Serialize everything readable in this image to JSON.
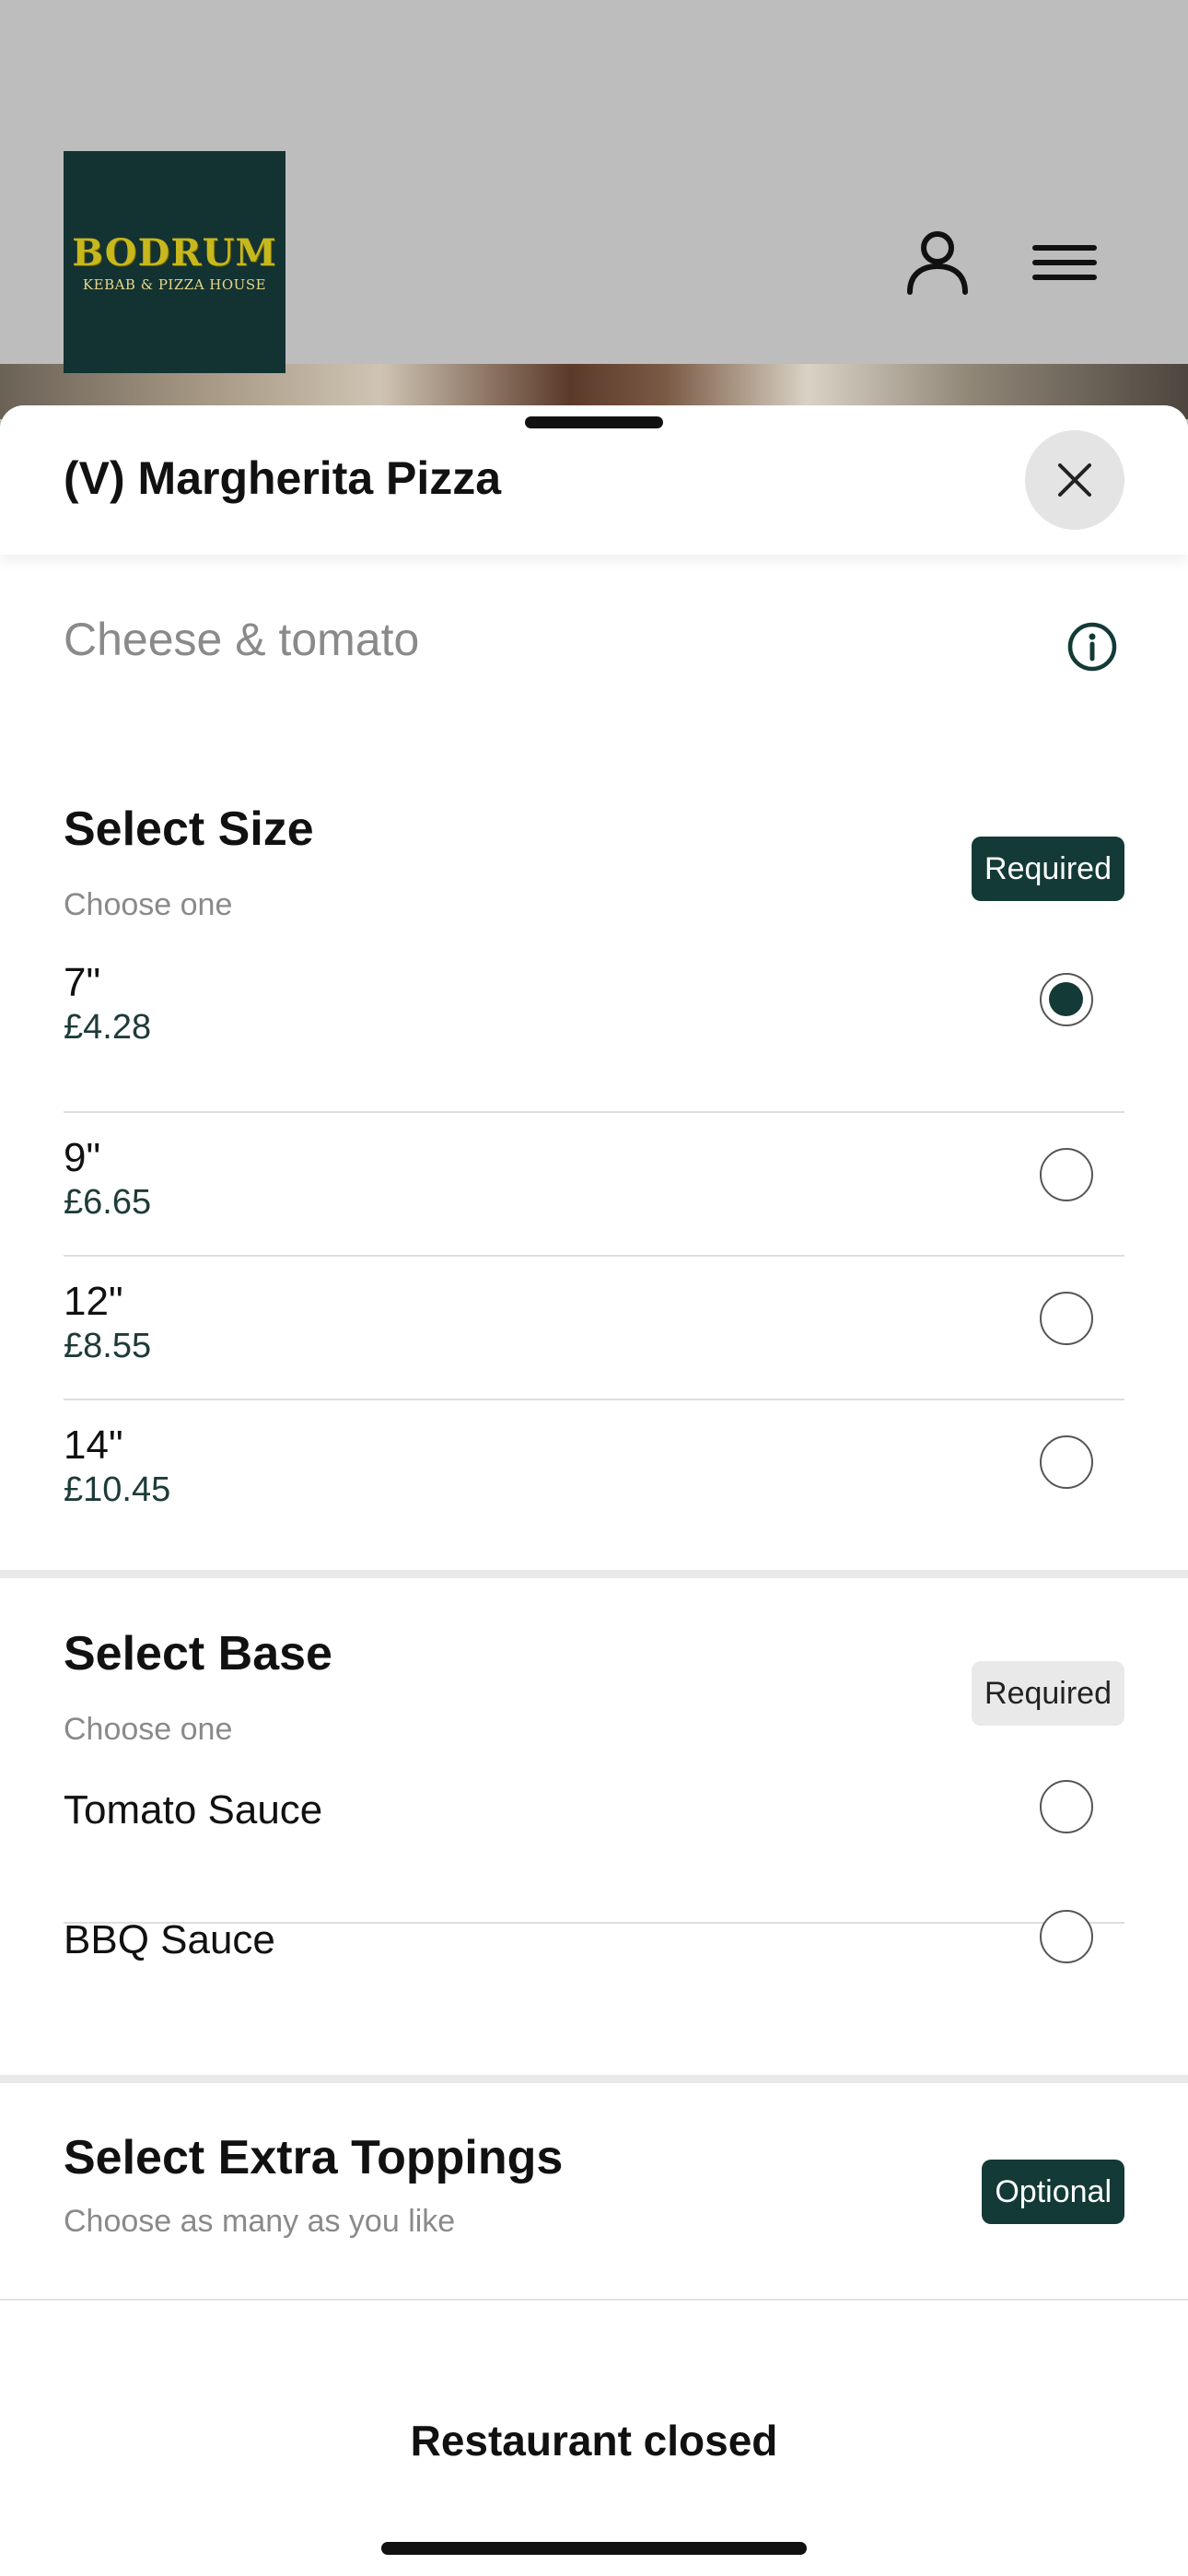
{
  "header": {
    "logo_title": "BODRUM",
    "logo_subtitle": "KEBAB & PIZZA HOUSE",
    "logo_colors": {
      "background": "#133232",
      "text": "#c7b81d"
    },
    "icons": [
      "user-icon",
      "menu-icon"
    ]
  },
  "sheet": {
    "title": "(V) Margherita Pizza",
    "description": "Cheese & tomato",
    "close_icon": "close-icon",
    "info_icon": "info-icon"
  },
  "size_section": {
    "title": "Select Size",
    "subtitle": "Choose one",
    "badge": "Required",
    "options": [
      {
        "name": "7\"",
        "price": "£4.28",
        "selected": true
      },
      {
        "name": "9\"",
        "price": "£6.65",
        "selected": false
      },
      {
        "name": "12\"",
        "price": "£8.55",
        "selected": false
      },
      {
        "name": "14\"",
        "price": "£10.45",
        "selected": false
      }
    ]
  },
  "base_section": {
    "title": "Select Base",
    "subtitle": "Choose one",
    "badge": "Required",
    "options": [
      {
        "name": "Tomato Sauce",
        "selected": false
      },
      {
        "name": "BBQ Sauce",
        "selected": false
      }
    ]
  },
  "toppings_section": {
    "title": "Select Extra Toppings",
    "subtitle": "Choose as many as you like",
    "badge": "Optional"
  },
  "footer": {
    "status": "Restaurant closed"
  },
  "colors": {
    "accent": "#133a36",
    "price": "#1d3b39",
    "header_background": "#bdbdbd"
  }
}
